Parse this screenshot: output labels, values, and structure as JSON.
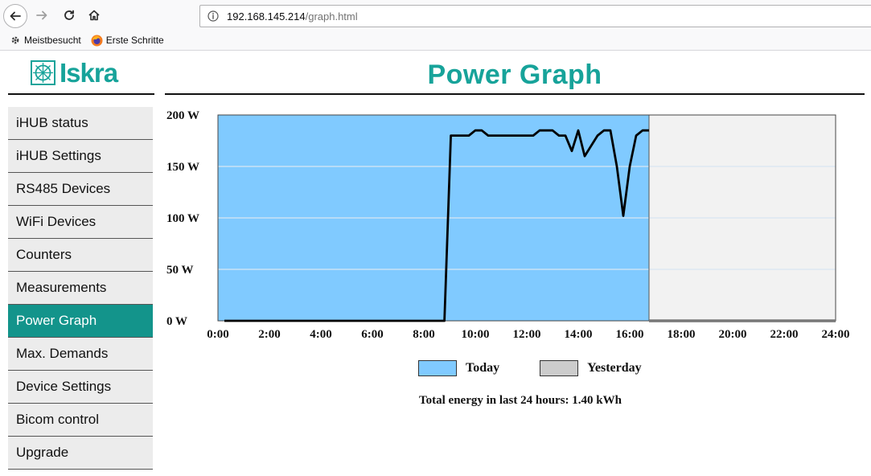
{
  "browser": {
    "url_host": "192.168.145.214",
    "url_path": "/graph.html",
    "bookmarks": [
      {
        "label": "Meistbesucht",
        "icon": "gear-icon"
      },
      {
        "label": "Erste Schritte",
        "icon": "firefox-icon"
      }
    ]
  },
  "logo": {
    "text": "Iskra"
  },
  "page": {
    "title": "Power Graph"
  },
  "sidebar": {
    "items": [
      {
        "label": "iHUB status",
        "active": false
      },
      {
        "label": "iHUB Settings",
        "active": false
      },
      {
        "label": "RS485 Devices",
        "active": false
      },
      {
        "label": "WiFi Devices",
        "active": false
      },
      {
        "label": "Counters",
        "active": false
      },
      {
        "label": "Measurements",
        "active": false
      },
      {
        "label": "Power Graph",
        "active": true
      },
      {
        "label": "Max. Demands",
        "active": false
      },
      {
        "label": "Device Settings",
        "active": false
      },
      {
        "label": "Bicom control",
        "active": false
      },
      {
        "label": "Upgrade",
        "active": false
      }
    ]
  },
  "chart_data": {
    "type": "line",
    "y_unit": "W",
    "ylim": [
      0,
      200
    ],
    "y_ticks": [
      {
        "value": 0,
        "label": "0 W"
      },
      {
        "value": 50,
        "label": "50 W"
      },
      {
        "value": 100,
        "label": "100 W"
      },
      {
        "value": 150,
        "label": "150 W"
      },
      {
        "value": 200,
        "label": "200 W"
      }
    ],
    "xlim": [
      0,
      24
    ],
    "x_ticks": [
      {
        "value": 0,
        "label": "0:00"
      },
      {
        "value": 2,
        "label": "2:00"
      },
      {
        "value": 4,
        "label": "4:00"
      },
      {
        "value": 6,
        "label": "6:00"
      },
      {
        "value": 8,
        "label": "8:00"
      },
      {
        "value": 10,
        "label": "10:00"
      },
      {
        "value": 12,
        "label": "12:00"
      },
      {
        "value": 14,
        "label": "14:00"
      },
      {
        "value": 16,
        "label": "16:00"
      },
      {
        "value": 18,
        "label": "18:00"
      },
      {
        "value": 20,
        "label": "20:00"
      },
      {
        "value": 22,
        "label": "22:00"
      },
      {
        "value": 24,
        "label": "24:00"
      }
    ],
    "grid": true,
    "today_end": 16.75,
    "series": [
      {
        "name": "Today",
        "area_color": "#80caff",
        "line_color": "#000000",
        "points": [
          [
            0.25,
            0
          ],
          [
            8.8,
            0
          ],
          [
            9.05,
            180
          ],
          [
            9.5,
            180
          ],
          [
            9.75,
            180
          ],
          [
            10,
            185
          ],
          [
            10.25,
            185
          ],
          [
            10.5,
            180
          ],
          [
            11,
            180
          ],
          [
            11.5,
            180
          ],
          [
            12,
            180
          ],
          [
            12.25,
            180
          ],
          [
            12.5,
            185
          ],
          [
            12.75,
            185
          ],
          [
            13,
            185
          ],
          [
            13.25,
            180
          ],
          [
            13.5,
            180
          ],
          [
            13.75,
            165
          ],
          [
            14,
            185
          ],
          [
            14.25,
            160
          ],
          [
            14.5,
            170
          ],
          [
            14.75,
            180
          ],
          [
            15,
            185
          ],
          [
            15.25,
            185
          ],
          [
            15.5,
            150
          ],
          [
            15.75,
            102
          ],
          [
            16,
            150
          ],
          [
            16.25,
            180
          ],
          [
            16.5,
            185
          ],
          [
            16.75,
            185
          ]
        ]
      },
      {
        "name": "Yesterday",
        "area_color": "#cccccc",
        "line_color": "#777777",
        "points": [
          [
            16.75,
            0
          ],
          [
            24,
            0
          ]
        ]
      }
    ],
    "legend": [
      {
        "label": "Today",
        "color": "#80caff"
      },
      {
        "label": "Yesterday",
        "color": "#cccccc"
      }
    ],
    "footer": "Total energy in last 24 hours: 1.40 kWh"
  }
}
